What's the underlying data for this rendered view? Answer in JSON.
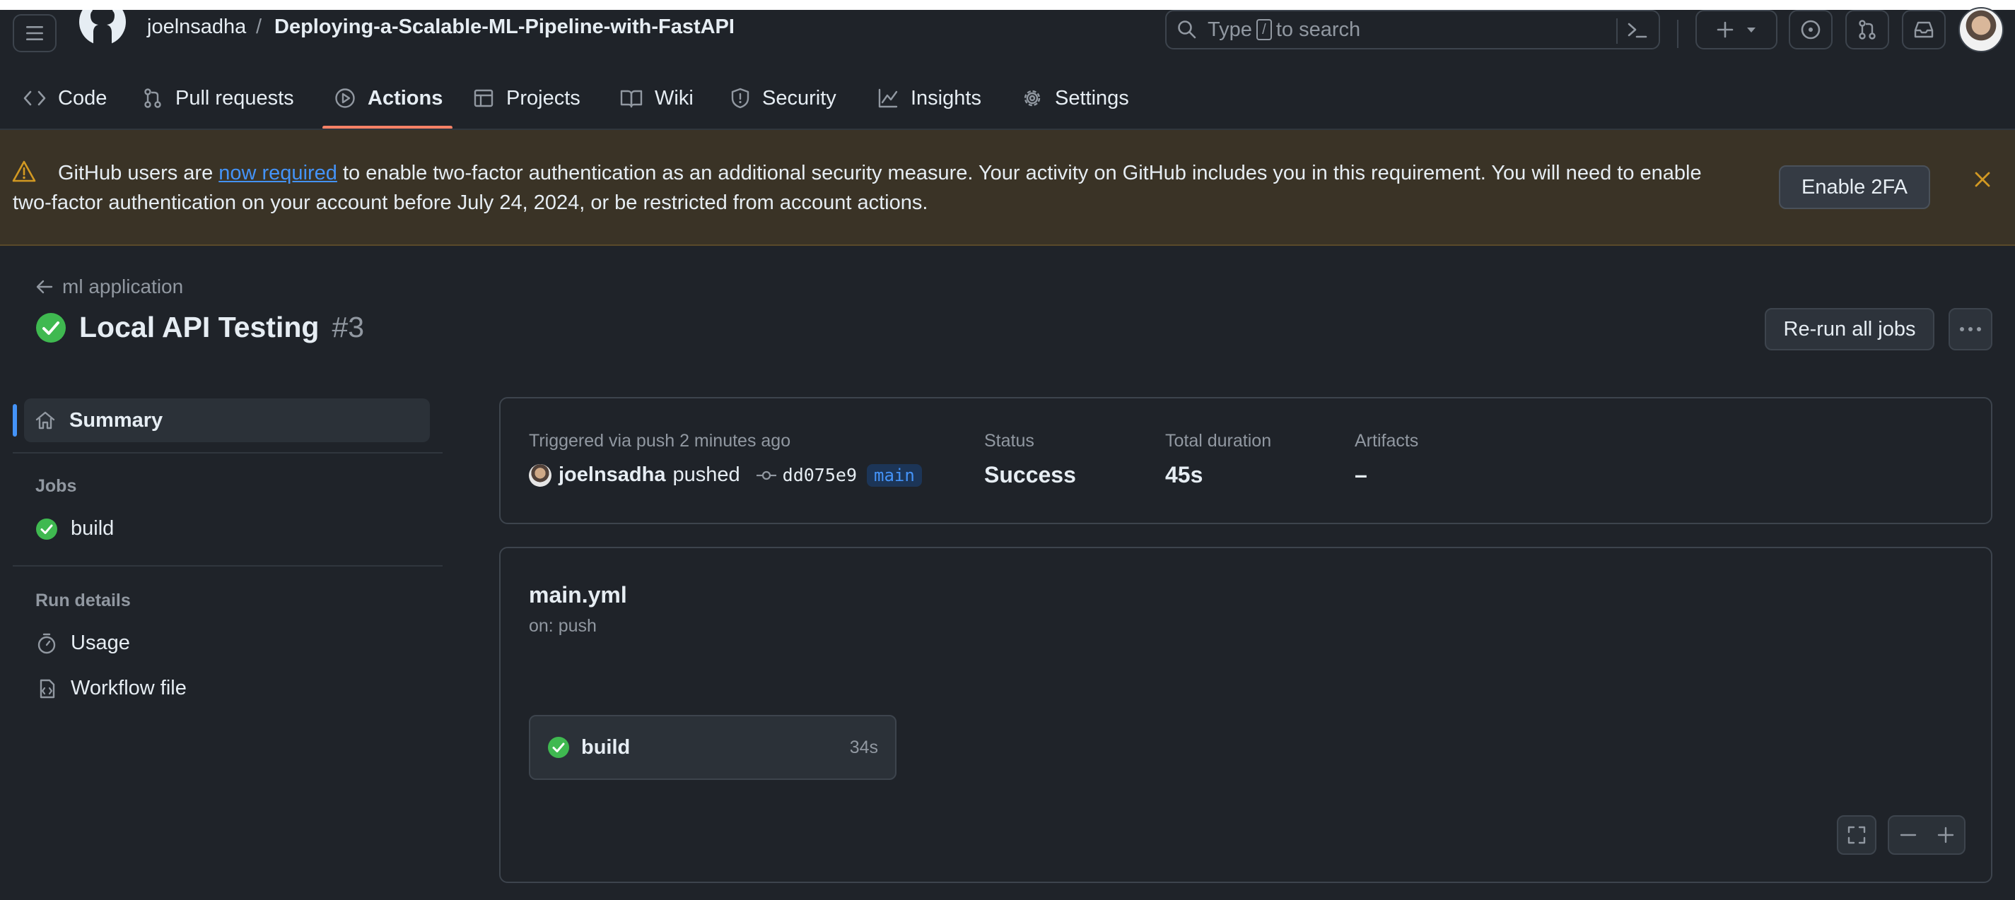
{
  "header": {
    "owner": "joelnsadha",
    "separator": "/",
    "repo": "Deploying-a-Scalable-ML-Pipeline-with-FastAPI",
    "search": {
      "prefix": "Type",
      "key": "/",
      "suffix": "to search"
    }
  },
  "nav": {
    "tabs": [
      {
        "label": "Code",
        "icon": "code-icon"
      },
      {
        "label": "Pull requests",
        "icon": "pull-request-icon"
      },
      {
        "label": "Actions",
        "icon": "play-icon",
        "active": true
      },
      {
        "label": "Projects",
        "icon": "table-icon"
      },
      {
        "label": "Wiki",
        "icon": "book-icon"
      },
      {
        "label": "Security",
        "icon": "shield-icon"
      },
      {
        "label": "Insights",
        "icon": "graph-icon"
      },
      {
        "label": "Settings",
        "icon": "gear-icon"
      }
    ]
  },
  "banner": {
    "text_before": "GitHub users are ",
    "link": "now required",
    "text_after": " to enable two-factor authentication as an additional security measure. Your activity on GitHub includes you in this requirement. You will need to enable two-factor authentication on your account before July 24, 2024, or be restricted from account actions.",
    "button": "Enable 2FA"
  },
  "run": {
    "back_link": "ml application",
    "title": "Local API Testing",
    "number": "#3",
    "rerun_button": "Re-run all jobs"
  },
  "sidebar": {
    "summary": "Summary",
    "jobs_heading": "Jobs",
    "jobs": [
      "build"
    ],
    "run_details_heading": "Run details",
    "details": [
      "Usage",
      "Workflow file"
    ]
  },
  "summary": {
    "triggered": "Triggered via push 2 minutes ago",
    "user": "joelnsadha",
    "action": "pushed",
    "sha": "dd075e9",
    "branch": "main",
    "status_label": "Status",
    "status_value": "Success",
    "duration_label": "Total duration",
    "duration_value": "45s",
    "artifacts_label": "Artifacts",
    "artifacts_value": "–"
  },
  "workflow": {
    "file": "main.yml",
    "trigger": "on: push",
    "job_name": "build",
    "job_duration": "34s"
  },
  "colors": {
    "success": "#3fb950",
    "accent": "#4493f8",
    "active_tab": "#f78166",
    "banner_bg": "#3a3326"
  }
}
